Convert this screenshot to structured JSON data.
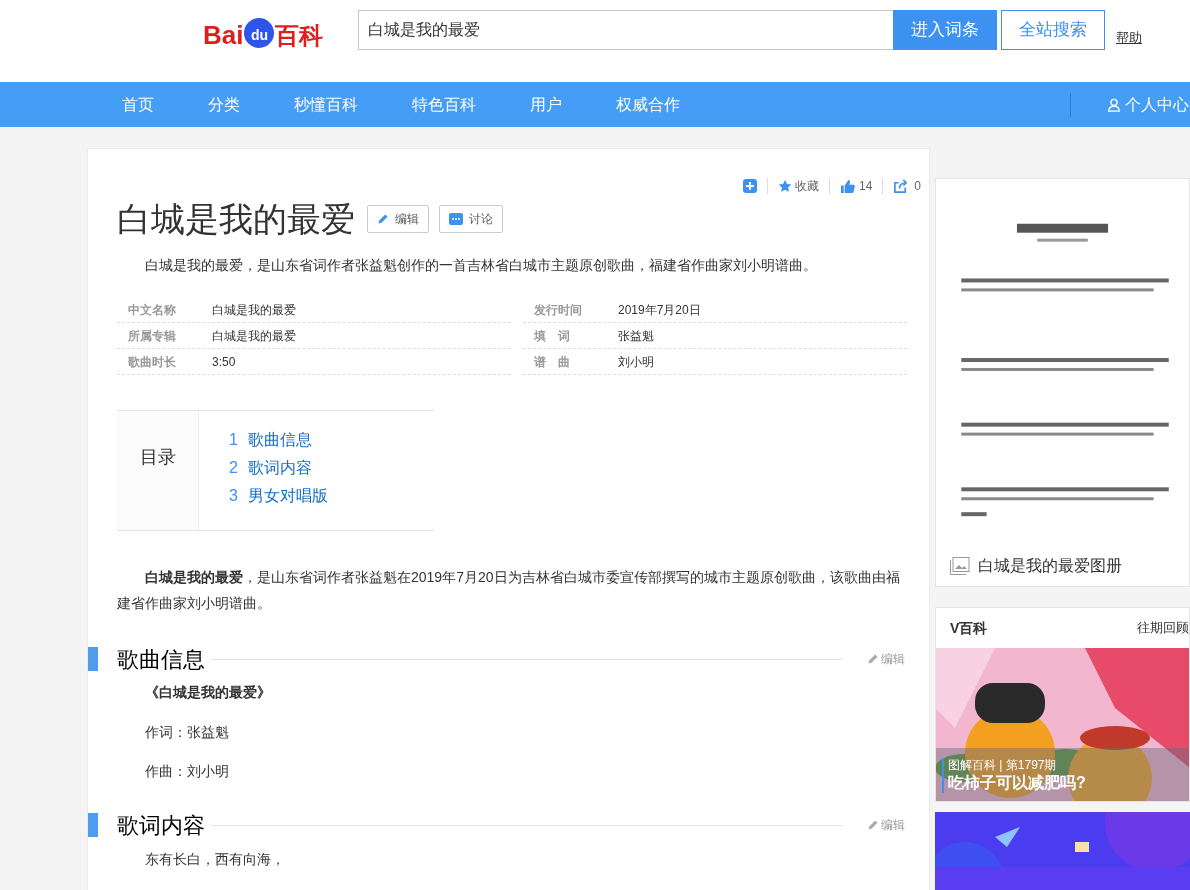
{
  "header": {
    "logo": {
      "part_1": "Bai",
      "part_2": "du",
      "part_3": "百科"
    },
    "search": {
      "value": "白城是我的最爱"
    },
    "buttons": [
      "进入词条",
      "全站搜索"
    ],
    "help_link": "帮助"
  },
  "nav": {
    "items": [
      {
        "label": "首页"
      },
      {
        "label": "分类"
      },
      {
        "label": "秒懂百科"
      },
      {
        "label": "特色百科"
      },
      {
        "label": "用户"
      },
      {
        "label": "权威合作"
      }
    ],
    "user_link": "个人中心"
  },
  "article": {
    "toolbar": {
      "favorite": "收藏",
      "likes": "14",
      "shares": "0"
    },
    "title": "白城是我的最爱",
    "title_buttons": [
      "编辑",
      "讨论"
    ],
    "summary": "白城是我的最爱，是山东省词作者张益魁创作的一首吉林省白城市主题原创歌曲，福建省作曲家刘小明谱曲。",
    "infobox": [
      [
        {
          "label": "中文名称",
          "value": "白城是我的最爱"
        },
        {
          "label": "所属专辑",
          "value": "白城是我的最爱"
        },
        {
          "label": "歌曲时长",
          "value": "3:50"
        }
      ],
      [
        {
          "label": "发行时间",
          "value": "2019年7月20日"
        },
        {
          "label": "填　词",
          "value": "张益魁"
        },
        {
          "label": "谱　曲",
          "value": "刘小明"
        }
      ]
    ],
    "toc": {
      "heading": "目录",
      "items": [
        {
          "number": "1",
          "label": "歌曲信息"
        },
        {
          "number": "2",
          "label": "歌词内容"
        },
        {
          "number": "3",
          "label": "男女对唱版"
        }
      ]
    },
    "intro": "**白城是我的最爱**，是山东省词作者张益魁在2019年7月20日为吉林省白城市委宣传部撰写的城市主题原创歌曲，该歌曲由福建省作曲家刘小明谱曲。",
    "sections": [
      {
        "heading": "歌曲信息",
        "edit": "编辑",
        "paragraphs": [
          {
            "text": "《白城是我的最爱》",
            "bold": true
          },
          {
            "text": "作词：张益魁",
            "bold": false
          },
          {
            "text": "作曲：刘小明",
            "bold": false
          }
        ]
      },
      {
        "heading": "歌词内容",
        "edit": "编辑",
        "paragraphs": [
          {
            "text": "东有长白，西有向海，",
            "bold": false
          }
        ]
      }
    ]
  },
  "sidebar": {
    "album": {
      "caption": "白城是我的最爱图册"
    },
    "v_baike": {
      "title": "V百科",
      "more": "往期回顾",
      "feature": {
        "tag": "图解百科 | 第1797期",
        "headline": "吃柿子可以减肥吗?"
      }
    }
  }
}
